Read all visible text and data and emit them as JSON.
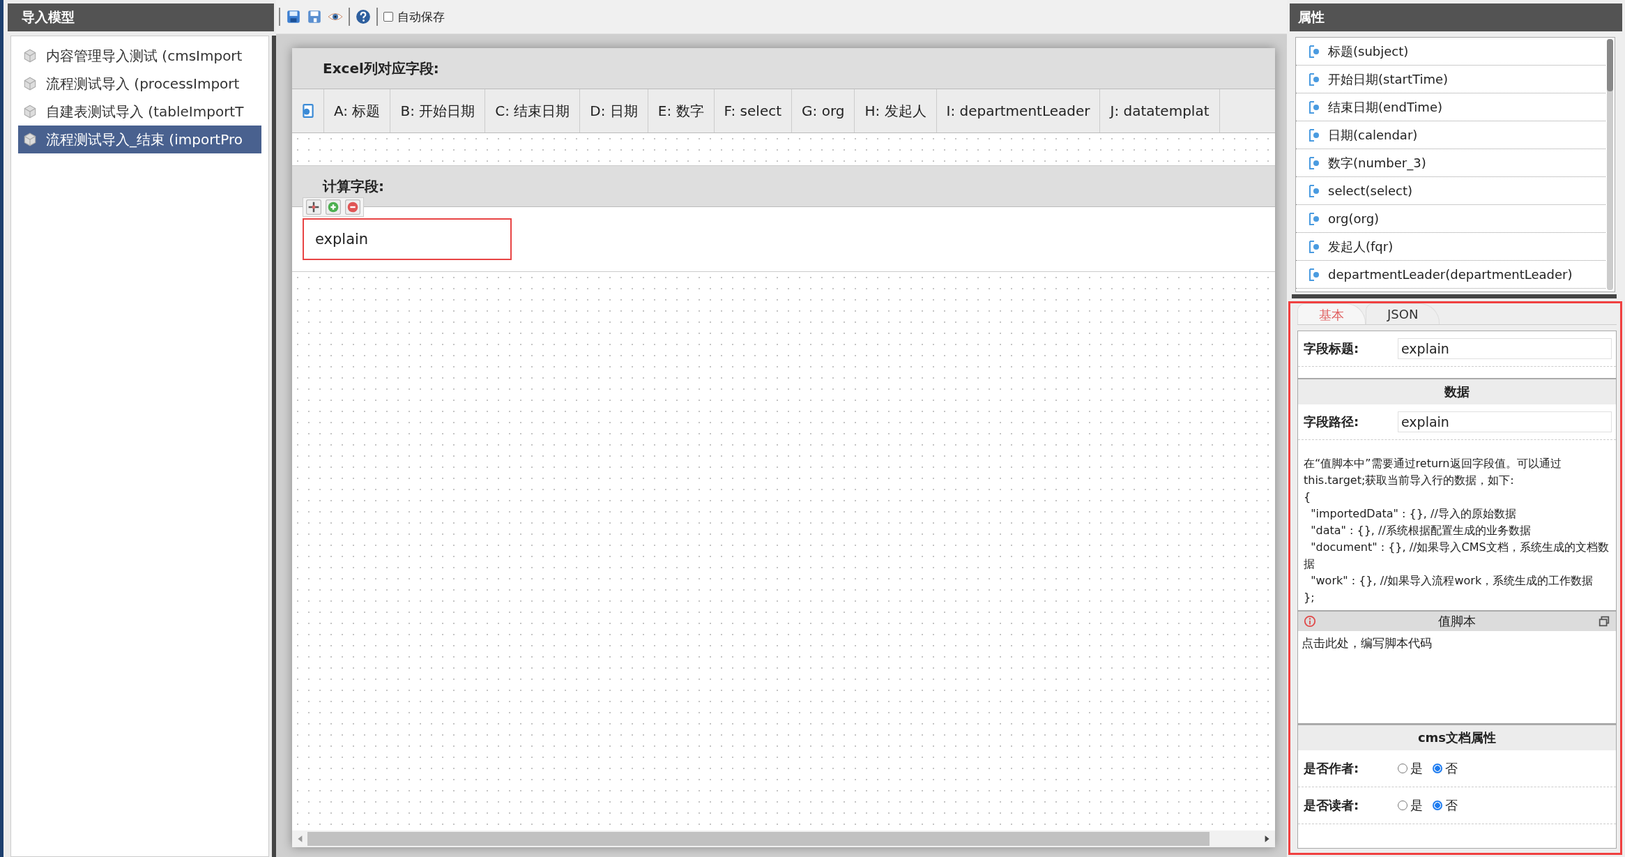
{
  "left_panel": {
    "title": "导入模型",
    "items": [
      {
        "label": "内容管理导入测试 (cmsImport",
        "selected": false
      },
      {
        "label": "流程测试导入 (processImport",
        "selected": false
      },
      {
        "label": "自建表测试导入 (tableImportT",
        "selected": false
      },
      {
        "label": "流程测试导入_结束 (importPro",
        "selected": true
      }
    ]
  },
  "toolbar": {
    "autosave": {
      "label": "自动保存",
      "checked": false
    }
  },
  "canvas": {
    "excel_title": "Excel列对应字段:",
    "columns": [
      "A: 标题",
      "B: 开始日期",
      "C: 结束日期",
      "D: 日期",
      "E: 数字",
      "F: select",
      "G: org",
      "H: 发起人",
      "I: departmentLeader",
      "J: datatemplat"
    ],
    "calc_title": "计算字段:",
    "calc_fields": [
      {
        "label": "explain",
        "selected": true
      }
    ]
  },
  "right_panel": {
    "title": "属性",
    "fields": [
      "标题(subject)",
      "开始日期(startTime)",
      "结束日期(endTime)",
      "日期(calendar)",
      "数字(number_3)",
      "select(select)",
      "org(org)",
      "发起人(fqr)",
      "departmentLeader(departmentLeader)"
    ],
    "tabs": [
      {
        "label": "基本",
        "selected": true
      },
      {
        "label": "JSON",
        "selected": false
      }
    ],
    "form": {
      "title_label": "字段标题:",
      "title_value": "explain",
      "data_section": "数据",
      "path_label": "字段路径:",
      "path_value": "explain",
      "help": "在“值脚本中”需要通过return返回字段值。可以通过this.target;获取当前导入行的数据，如下:\n{\n  \"importedData\" : {}, //导入的原始数据\n  \"data\" : {}, //系统根据配置生成的业务数据\n  \"document\" : {}, //如果导入CMS文档，系统生成的文档数据\n  \"work\" : {}, //如果导入流程work，系统生成的工作数据\n};",
      "script_title": "值脚本",
      "script_placeholder": "点击此处，编写脚本代码",
      "cms_section": "cms文档属性",
      "radios": [
        {
          "label": "是否作者:",
          "options": [
            {
              "label": "是",
              "selected": false
            },
            {
              "label": "否",
              "selected": true
            }
          ]
        },
        {
          "label": "是否读者:",
          "options": [
            {
              "label": "是",
              "selected": false
            },
            {
              "label": "否",
              "selected": true
            }
          ]
        }
      ]
    }
  }
}
